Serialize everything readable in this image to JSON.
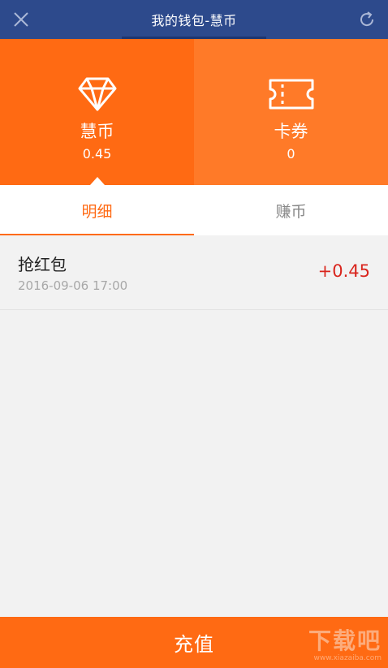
{
  "header": {
    "title": "我的钱包-慧币",
    "close_icon": "close-icon",
    "refresh_icon": "refresh-icon",
    "background": "#2d4a8c"
  },
  "tiles": [
    {
      "label": "慧币",
      "value": "0.45",
      "icon": "diamond-icon",
      "color": "#ff6a13"
    },
    {
      "label": "卡券",
      "value": "0",
      "icon": "ticket-icon",
      "color": "#ff7a28"
    }
  ],
  "tabs": [
    {
      "label": "明细",
      "active": true
    },
    {
      "label": "赚币",
      "active": false
    }
  ],
  "transactions": [
    {
      "name": "抢红包",
      "time": "2016-09-06 17:00",
      "amount": "+0.45"
    }
  ],
  "bottom_button": {
    "label": "充值",
    "color": "#ff6a13"
  },
  "watermark": {
    "main": "下载吧",
    "sub": "www.xiazaiba.com"
  },
  "colors": {
    "accent": "#ff6a13",
    "amount_positive": "#d9251d"
  }
}
